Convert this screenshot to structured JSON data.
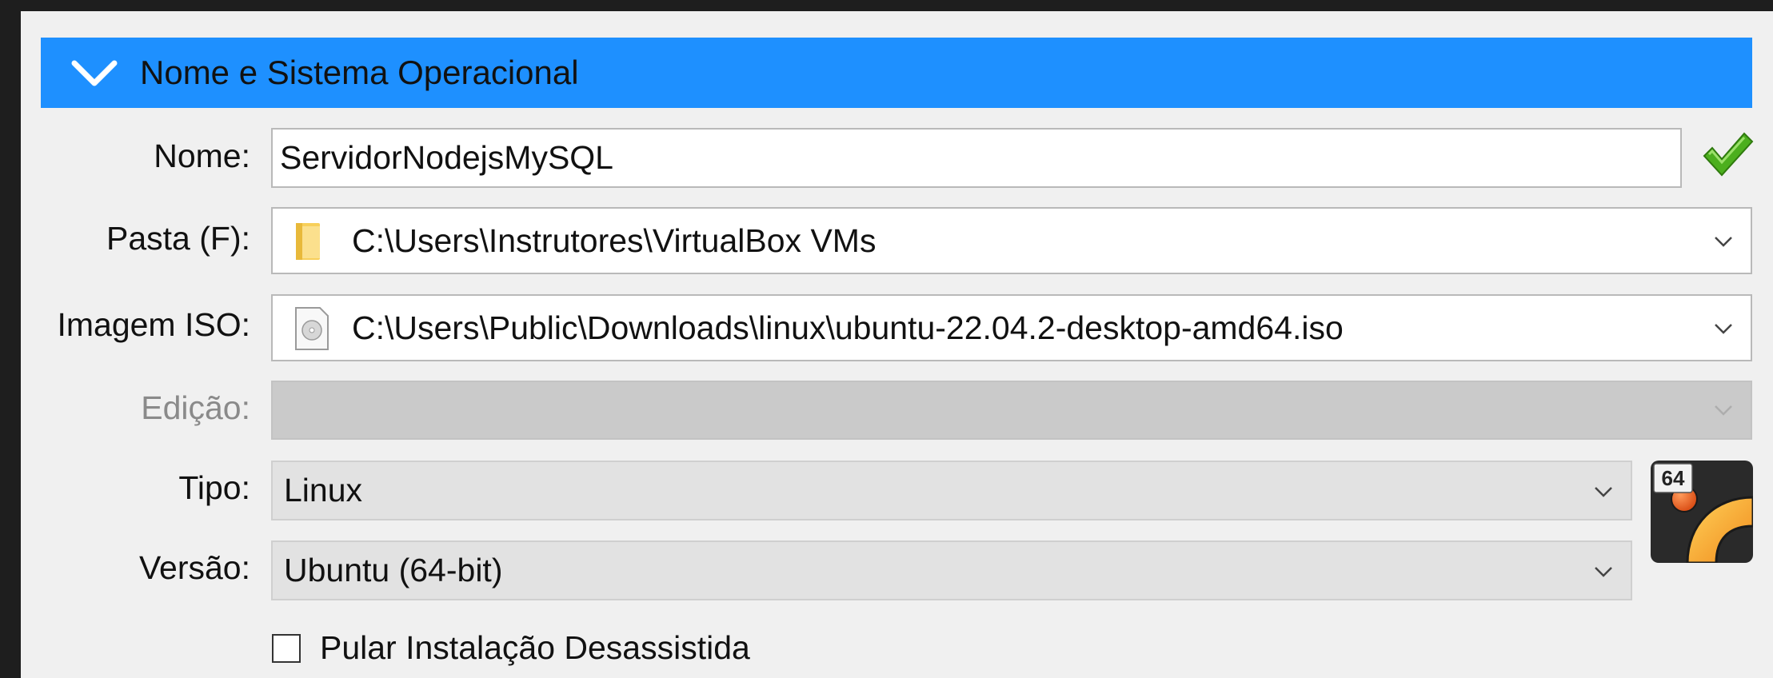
{
  "section": {
    "title": "Nome e Sistema Operacional",
    "icon": "chevron-down-icon"
  },
  "name": {
    "label": "Nome:",
    "value": "ServidorNodejsMySQL",
    "valid_icon": "check-icon"
  },
  "folder": {
    "label": "Pasta (F):",
    "value": "C:\\Users\\Instrutores\\VirtualBox VMs",
    "icon": "folder-icon"
  },
  "iso": {
    "label": "Imagem ISO:",
    "value": "C:\\Users\\Public\\Downloads\\linux\\ubuntu-22.04.2-desktop-amd64.iso",
    "icon": "disc-image-icon"
  },
  "edition": {
    "label": "Edição:",
    "value": ""
  },
  "type": {
    "label": "Tipo:",
    "value": "Linux"
  },
  "version": {
    "label": "Versão:",
    "value": "Ubuntu (64-bit)"
  },
  "os_logo": {
    "badge": "64",
    "icon": "ubuntu-logo-icon"
  },
  "unattended": {
    "label": "Pular Instalação Desassistida",
    "checked": false
  },
  "colors": {
    "header_bg": "#1e90ff",
    "check_green": "#4caf1e"
  }
}
